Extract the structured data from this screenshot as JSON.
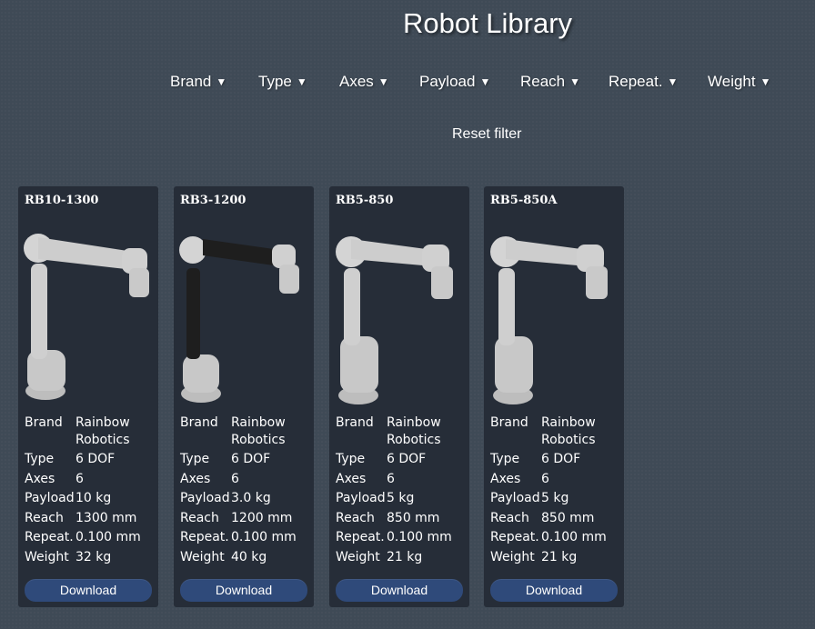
{
  "header": {
    "title": "Robot Library"
  },
  "filters": [
    {
      "label": "Brand"
    },
    {
      "label": "Type"
    },
    {
      "label": "Axes"
    },
    {
      "label": "Payload"
    },
    {
      "label": "Reach"
    },
    {
      "label": "Repeat."
    },
    {
      "label": "Weight"
    }
  ],
  "reset_label": "Reset filter",
  "spec_labels": [
    "Brand",
    "Type",
    "Axes",
    "Payload",
    "Reach",
    "Repeat.",
    "Weight"
  ],
  "cards": [
    {
      "name": "RB10-1300",
      "brand": "Rainbow Robotics",
      "type": "6 DOF",
      "axes": "6",
      "payload": "10 kg",
      "reach": "1300 mm",
      "repeat": "0.100 mm",
      "weight": "32 kg",
      "download": "Download"
    },
    {
      "name": "RB3-1200",
      "brand": "Rainbow Robotics",
      "type": "6 DOF",
      "axes": "6",
      "payload": "3.0 kg",
      "reach": "1200 mm",
      "repeat": "0.100 mm",
      "weight": "40 kg",
      "download": "Download"
    },
    {
      "name": "RB5-850",
      "brand": "Rainbow Robotics",
      "type": "6 DOF",
      "axes": "6",
      "payload": "5 kg",
      "reach": "850 mm",
      "repeat": "0.100 mm",
      "weight": "21 kg",
      "download": "Download"
    },
    {
      "name": "RB5-850A",
      "brand": "Rainbow Robotics",
      "type": "6 DOF",
      "axes": "6",
      "payload": "5 kg",
      "reach": "850 mm",
      "repeat": "0.100 mm",
      "weight": "21 kg",
      "download": "Download"
    }
  ],
  "colors": {
    "background": "#3f4a56",
    "card": "#262d38",
    "button": "#2f4a7a"
  },
  "icons": {
    "filter_caret": "caret-down-icon"
  }
}
